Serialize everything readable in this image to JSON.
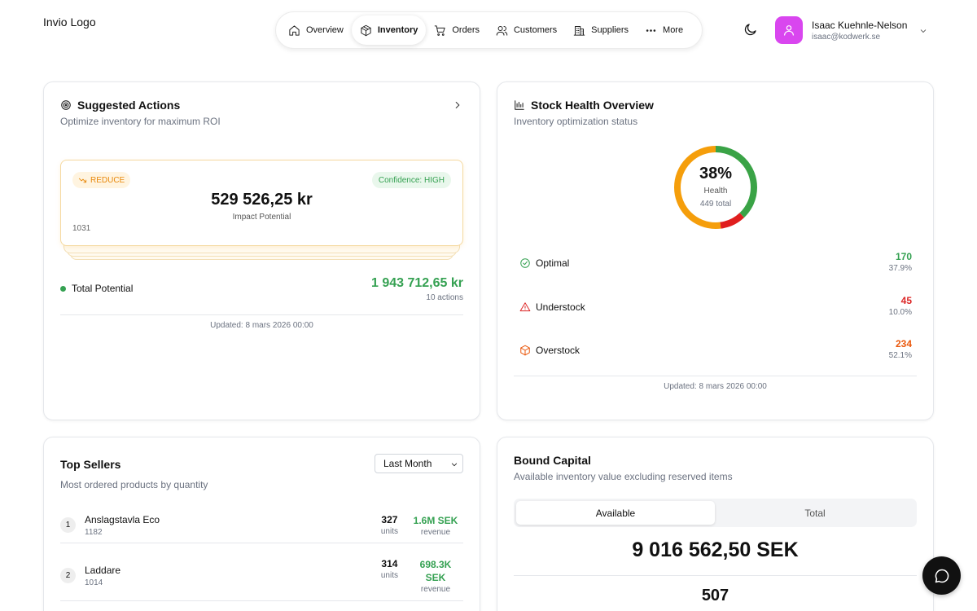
{
  "logo": {
    "alt": "Invio Logo"
  },
  "nav": {
    "items": [
      {
        "label": "Overview",
        "icon": "home-icon"
      },
      {
        "label": "Inventory",
        "icon": "box-icon",
        "active": true
      },
      {
        "label": "Orders",
        "icon": "cart-icon"
      },
      {
        "label": "Customers",
        "icon": "users-icon"
      },
      {
        "label": "Suppliers",
        "icon": "building-icon"
      },
      {
        "label": "More",
        "icon": "more-dots-icon"
      }
    ]
  },
  "user": {
    "name": "Isaac Kuehnle-Nelson",
    "email": "isaac@kodwerk.se",
    "avatar_color": "#d946ef"
  },
  "suggested_actions": {
    "title": "Suggested Actions",
    "subtitle": "Optimize inventory for maximum ROI",
    "card": {
      "type_badge": "REDUCE",
      "confidence": "Confidence: HIGH",
      "impact_value": "529 526,25 kr",
      "impact_label": "Impact Potential",
      "item_id": "1031"
    },
    "total_label": "Total Potential",
    "total_value": "1 943 712,65 kr",
    "total_actions": "10 actions",
    "updated": "Updated: 8 mars 2026 00:00"
  },
  "stock_health": {
    "title": "Stock Health Overview",
    "subtitle": "Inventory optimization status",
    "health_pct": "38%",
    "health_label": "Health",
    "total_label": "449 total",
    "rows": [
      {
        "label": "Optimal",
        "count": "170",
        "pct": "37.9%",
        "color": "#35a152",
        "icon": "check-circle-icon"
      },
      {
        "label": "Understock",
        "count": "45",
        "pct": "10.0%",
        "color": "#dc2626",
        "icon": "warning-triangle-icon"
      },
      {
        "label": "Overstock",
        "count": "234",
        "pct": "52.1%",
        "color": "#ea580c",
        "icon": "package-icon"
      }
    ],
    "updated": "Updated: 8 mars 2026 00:00",
    "colors": {
      "optimal": "#3aa346",
      "understock": "#e01e1e",
      "overstock": "#f59e0b"
    }
  },
  "top_sellers": {
    "title": "Top Sellers",
    "subtitle": "Most ordered products by quantity",
    "period": "Last Month",
    "units_label": "units",
    "revenue_label": "revenue",
    "items": [
      {
        "rank": "1",
        "name": "Anslagstavla Eco",
        "sku": "1182",
        "units": "327",
        "revenue": "1.6M SEK"
      },
      {
        "rank": "2",
        "name": "Laddare",
        "sku": "1014",
        "units": "314",
        "revenue": "698.3K SEK"
      }
    ]
  },
  "bound_capital": {
    "title": "Bound Capital",
    "subtitle": "Available inventory value excluding reserved items",
    "tabs": [
      "Available",
      "Total"
    ],
    "value": "9 016 562,50 SEK",
    "count": "507"
  }
}
